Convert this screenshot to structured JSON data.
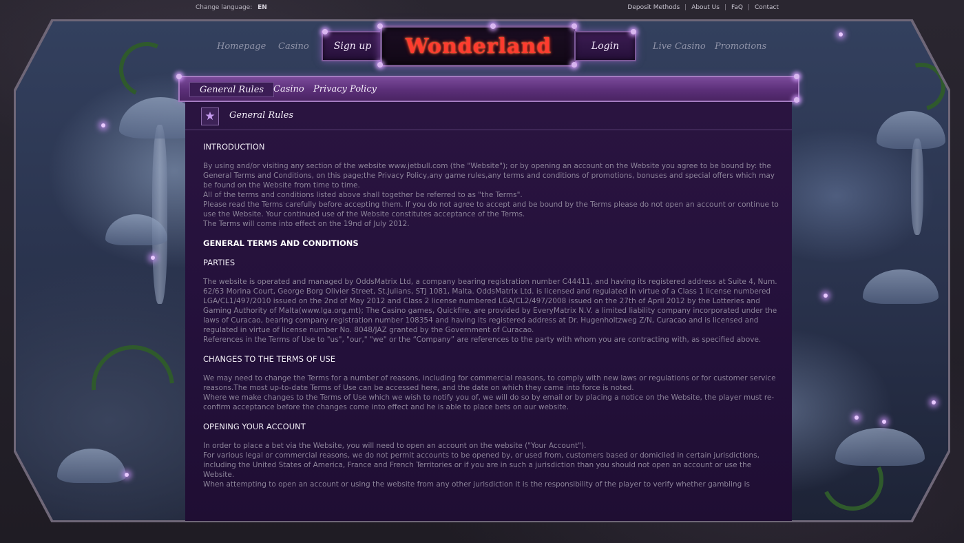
{
  "topbar": {
    "change_language_label": "Change language:",
    "language_code": "EN",
    "links": [
      "Deposit Methods",
      "About Us",
      "FaQ",
      "Contact"
    ]
  },
  "header": {
    "nav_left": [
      "Homepage",
      "Casino"
    ],
    "sign_up": "Sign up",
    "logo": "Wonderland",
    "login": "Login",
    "nav_right": [
      "Live Casino",
      "Promotions"
    ]
  },
  "tabs": {
    "items": [
      "General Rules",
      "Casino",
      "Privacy Policy"
    ],
    "active": "General Rules"
  },
  "panel": {
    "title": "General Rules"
  },
  "content": {
    "introduction": {
      "heading": "INTRODUCTION",
      "paragraphs": [
        "By using and/or visiting any section of the website www.jetbull.com (the \"Website\"); or by opening an account on the Website you agree to be bound by: the General Terms and Conditions, on this page;the Privacy Policy,any game rules,any terms and conditions of promotions, bonuses and special offers which may be found on the Website from time to time.",
        "All of the terms and conditions listed above shall together be referred to as \"the Terms\".",
        "Please read the Terms carefully before accepting them. If you do not agree to accept and be bound by the Terms please do not open an account or continue to use the Website. Your continued use of the Website constitutes acceptance of the Terms.",
        "The Terms will come into effect on the 19nd of July 2012."
      ]
    },
    "general_heading": "GENERAL TERMS AND CONDITIONS",
    "parties": {
      "heading": "PARTIES",
      "paragraphs": [
        "The website is operated and managed by OddsMatrix Ltd, a company bearing registration number C44411, and having its registered address at Suite 4, Num. 62/63 Morina Court, George Borg Olivier Street, St.Julians, STJ 1081, Malta. OddsMatrix Ltd. is licensed and regulated in virtue of a Class 1 license numbered LGA/CL1/497/2010 issued on the 2nd of May 2012 and  Class 2 license numbered LGA/CL2/497/2008 issued on the 27th of April 2012 by the Lotteries and Gaming Authority of Malta(www.lga.org.mt); The Casino games, Quickfire, are provided by EveryMatrix N.V. a limited liability   company incorporated under the laws of Curacao, bearing company registration number 108354 and having its registered address at Dr. Hugenholtzweg Z/N, Curacao and is licensed and regulated in virtue of license number No. 8048/JAZ granted by the Government of Curacao.",
        "References in the Terms of Use to \"us\", \"our,\" \"we\" or the “Company” are references to the party with whom you are contracting with, as specified above."
      ]
    },
    "changes": {
      "heading": "CHANGES TO THE TERMS OF USE",
      "paragraphs": [
        "We may need to change the Terms for a number of reasons, including for commercial reasons, to comply with new laws or regulations or for customer service reasons.The most up-to-date Terms of Use can be accessed here, and the date on which they came into force is noted.",
        "Where we make changes to the Terms of Use which we wish to notify you of, we will do so by email or by placing a notice on the Website, the player must re-confirm acceptance before the changes come into effect and he is able to place bets on our website."
      ]
    },
    "opening": {
      "heading": "OPENING YOUR ACCOUNT",
      "paragraphs": [
        "In order to place a bet via the Website, you will need to open an account on the website (\"Your Account\").",
        "For various legal or commercial reasons, we do not permit accounts to be opened by, or used from, customers based or domiciled in certain jurisdictions, including the United States of America, France and French Territories or if you are in such a jurisdiction than you should not open an account or use the Website.",
        "When attempting to open an account or using the website from any other jurisdiction it is the responsibility of the player to verify whether gambling is"
      ]
    }
  }
}
